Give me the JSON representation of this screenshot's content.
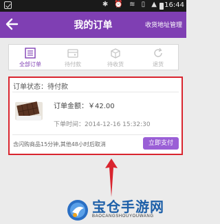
{
  "status_bar": {
    "time": "16:44",
    "icons": [
      "bluetooth-icon",
      "alarm-icon",
      "wifi-icon",
      "sim-icon",
      "signal-icon",
      "battery-icon"
    ]
  },
  "header": {
    "title": "我的订单",
    "address_link": "收货地址管理",
    "background": "#7f3fb3"
  },
  "tabs": [
    {
      "label": "全部订单",
      "icon": "list-icon",
      "active": true
    },
    {
      "label": "待付款",
      "icon": "wallet-icon",
      "active": false
    },
    {
      "label": "待收货",
      "icon": "package-icon",
      "active": false
    },
    {
      "label": "退货",
      "icon": "refresh-icon",
      "active": false
    }
  ],
  "order": {
    "status": "订单状态：待付款",
    "amount": "订单金额：￥42.00",
    "time": "下单时间：2014-12-16 15:32:30",
    "notice": "含闪购商品15分钟,其他48小时后取消",
    "pay_button": "立即支付",
    "product_icon": "chocolate-bar-image",
    "highlight_color": "#d9242e"
  },
  "watermark": {
    "title": "宝仓手游网",
    "subtitle": "BAOCANGSHOUYOUWANG"
  }
}
